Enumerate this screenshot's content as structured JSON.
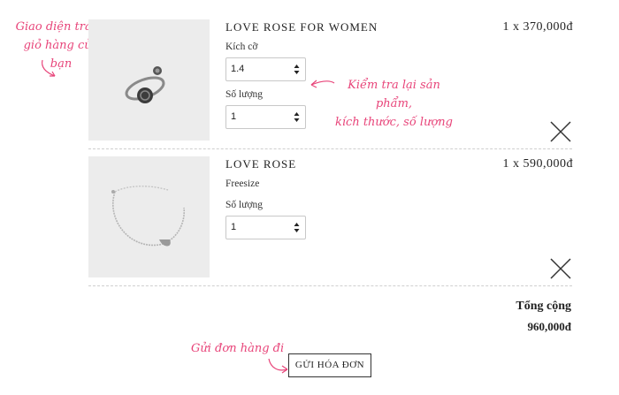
{
  "annotations": {
    "cart_line1": "Giao diện trang",
    "cart_line2": "giỏ hàng của bạn",
    "check_line1": "Kiểm tra lại sản phẩm,",
    "check_line2": "kích thước, số lượng",
    "send": "Gửi đơn hàng đi"
  },
  "items": [
    {
      "name": "LOVE ROSE FOR WOMEN",
      "price": "1 x 370,000đ",
      "size_label": "Kích cỡ",
      "size_value": "1.4",
      "qty_label": "Số lượng",
      "qty_value": "1"
    },
    {
      "name": "LOVE ROSE",
      "price": "1 x 590,000đ",
      "size_text": "Freesize",
      "qty_label": "Số lượng",
      "qty_value": "1"
    }
  ],
  "summary": {
    "total_label": "Tổng cộng",
    "total_value": "960,000đ"
  },
  "submit_label": "GỬI HÓA ĐƠN",
  "colors": {
    "annotation": "#e8457a",
    "thumbnail_bg": "#ececec",
    "border": "#c8c8c8"
  }
}
